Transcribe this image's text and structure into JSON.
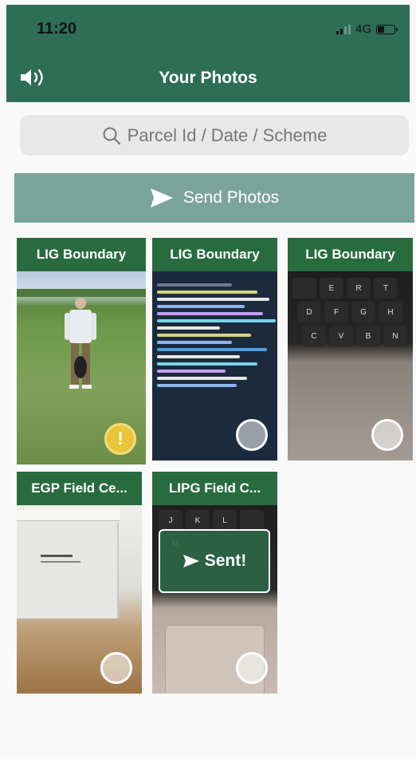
{
  "status": {
    "time": "11:20",
    "network": "4G"
  },
  "header": {
    "title": "Your Photos"
  },
  "search": {
    "placeholder": "Parcel Id / Date / Scheme"
  },
  "actions": {
    "send_label": "Send Photos"
  },
  "photos": [
    {
      "label": "LIG Boundary",
      "status": "warning"
    },
    {
      "label": "LIG Boundary",
      "status": "pending"
    },
    {
      "label": "LIG Boundary",
      "status": "pending"
    },
    {
      "label": "EGP Field Ce...",
      "status": "pending"
    },
    {
      "label": "LIPG Field C...",
      "status": "sent",
      "overlay": "Sent!"
    }
  ],
  "colors": {
    "header": "#2e6e57",
    "send_bar": "#7aa49a",
    "card_label": "#286b3f",
    "warning": "#eac53a"
  },
  "icons": {
    "speaker": "speaker-icon",
    "search": "search-icon",
    "send": "send-icon"
  }
}
